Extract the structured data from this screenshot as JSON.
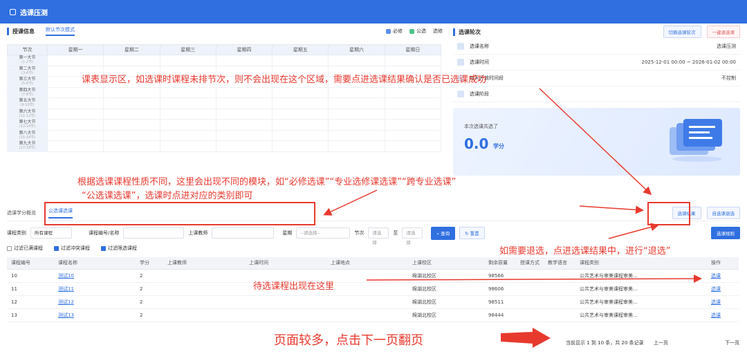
{
  "app": {
    "title": "选课压测"
  },
  "schedule": {
    "section_title": "授课信息",
    "tab": "默认节次模式",
    "legend": [
      {
        "label": "必修",
        "color": "#5b8def"
      },
      {
        "label": "公选",
        "color": "#4cc38a"
      },
      {
        "label": "选修",
        "color": "#f5a623"
      }
    ],
    "headers": [
      "节次",
      "星期一",
      "星期二",
      "星期三",
      "星期四",
      "星期五",
      "星期六",
      "星期日"
    ],
    "periods": [
      {
        "name": "第一大节",
        "sub": "(1-2节)"
      },
      {
        "name": "第二大节",
        "sub": "(3-4节)"
      },
      {
        "name": "第三大节",
        "sub": "(5-6节)"
      },
      {
        "name": "第四大节",
        "sub": "(7-8节)"
      },
      {
        "name": "第五大节",
        "sub": "(9-10节)"
      },
      {
        "name": "第六大节",
        "sub": "(11-12节)"
      },
      {
        "name": "第七大节",
        "sub": "(13-14节)"
      },
      {
        "name": "第八大节",
        "sub": "(15-16节)"
      },
      {
        "name": "第九大节",
        "sub": "(17-18节)"
      }
    ]
  },
  "round": {
    "section_title": "选课轮次",
    "btn_switch": "切换选课轮次",
    "btn_cancel": "一键退选课",
    "rows": [
      {
        "label": "选课名称",
        "value": "选课压测"
      },
      {
        "label": "选课时间",
        "value": "2025-12-01 00:00 ~ 2026-01-02 00:00"
      },
      {
        "label": "每天开放时间段",
        "value": "不控制"
      },
      {
        "label": "选课阶段",
        "value": ""
      }
    ],
    "summary_label": "本次选课共选了",
    "summary_value": "0.0",
    "summary_unit": "学分"
  },
  "courses": {
    "tab_credit": "选课学分概览",
    "tab_public": "公选课选课",
    "btn_result": "选课结果",
    "btn_return": "自选课退选",
    "btn_pick": "选课规则",
    "filters": {
      "type_label": "课程类别",
      "type_value": "所有课程",
      "name_label": "课程编号/名称",
      "teacher_label": "上课教师",
      "week_label": "星期",
      "week_value": "--请选择--",
      "period_label": "节次",
      "period_from": "请选择",
      "period_to_sep": "至",
      "period_to": "请选择",
      "search": "查询",
      "reset": "重置"
    },
    "checks": [
      {
        "label": "过滤已满课程",
        "checked": false
      },
      {
        "label": "过滤冲突课程",
        "checked": true
      },
      {
        "label": "过滤限选课程",
        "checked": true
      }
    ],
    "columns": [
      "课程编号",
      "课程名称",
      "学分",
      "上课教师",
      "上课时间",
      "上课地点",
      "上课校区",
      "剩余容量",
      "授课方式",
      "教学语言",
      "课程类别",
      "操作"
    ],
    "rows": [
      {
        "id": "10",
        "name": "测试10",
        "credit": "2",
        "campus": "棉湖北校区",
        "cap": "98566",
        "type": "公共艺术与审美课程审美…",
        "op": "选课"
      },
      {
        "id": "11",
        "name": "测试11",
        "credit": "2",
        "campus": "棉湖北校区",
        "cap": "98606",
        "type": "公共艺术与审美课程审美…",
        "op": "选课"
      },
      {
        "id": "12",
        "name": "测试12",
        "credit": "2",
        "campus": "棉湖北校区",
        "cap": "98511",
        "type": "公共艺术与审美课程审美…",
        "op": "选课"
      },
      {
        "id": "13",
        "name": "测试13",
        "credit": "2",
        "campus": "棉湖北校区",
        "cap": "98444",
        "type": "公共艺术与审美课程审美…",
        "op": "选课"
      }
    ],
    "pager_text": "当前显示 1 到 10 条，共 20 条记录",
    "prev": "上一页",
    "next": "下一页"
  },
  "annotations": {
    "a1": "课表显示区，如选课时课程未排节次，则不会出现在这个区域，需要点进选课结果确认是否已选课成功",
    "a2_line1": "根据选课课程性质不同，这里会出现不同的模块，如“必修选课”“专业选修课选课”“跨专业选课”",
    "a2_line2": "“公选课选课”，选课时点进对应的类别即可",
    "a3": "如需要退选，点进选课结果中，进行“退选”",
    "a4": "待选课程出现在这里",
    "a5": "页面较多，点击下一页翻页"
  }
}
